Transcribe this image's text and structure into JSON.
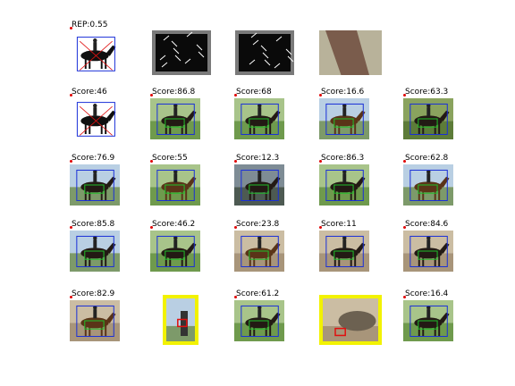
{
  "title": "",
  "header_row": [
    {
      "label": "REP:0.55",
      "kind": "silhouette"
    },
    {
      "label": "",
      "kind": "hog"
    },
    {
      "label": "",
      "kind": "hog"
    },
    {
      "label": "",
      "kind": "patch"
    }
  ],
  "detections": [
    [
      {
        "label": "Score:46",
        "kind": "silhouette",
        "tone": "white",
        "highlight": false
      },
      {
        "label": "Score:86.8",
        "kind": "photo",
        "tone": "grass",
        "highlight": false
      },
      {
        "label": "Score:68",
        "kind": "photo",
        "tone": "grass",
        "highlight": false
      },
      {
        "label": "Score:16.6",
        "kind": "photo",
        "tone": "sky",
        "highlight": false
      },
      {
        "label": "Score:63.3",
        "kind": "photo",
        "tone": "brown",
        "highlight": false
      }
    ],
    [
      {
        "label": "Score:76.9",
        "kind": "photo",
        "tone": "sky",
        "highlight": false
      },
      {
        "label": "Score:55",
        "kind": "photo",
        "tone": "grass",
        "highlight": false
      },
      {
        "label": "Score:12.3",
        "kind": "photo",
        "tone": "dark",
        "highlight": false
      },
      {
        "label": "Score:86.3",
        "kind": "photo",
        "tone": "grass",
        "highlight": false
      },
      {
        "label": "Score:62.8",
        "kind": "photo",
        "tone": "sky",
        "highlight": false
      }
    ],
    [
      {
        "label": "Score:85.8",
        "kind": "photo",
        "tone": "sky",
        "highlight": false
      },
      {
        "label": "Score:46.2",
        "kind": "photo",
        "tone": "grass",
        "highlight": false
      },
      {
        "label": "Score:23.8",
        "kind": "photo",
        "tone": "sand",
        "highlight": false
      },
      {
        "label": "Score:11",
        "kind": "photo",
        "tone": "sand",
        "highlight": false
      },
      {
        "label": "Score:84.6",
        "kind": "photo",
        "tone": "sand",
        "highlight": false
      }
    ],
    [
      {
        "label": "Score:82.9",
        "kind": "photo",
        "tone": "sand",
        "highlight": false
      },
      {
        "label": "",
        "kind": "person",
        "tone": "sky",
        "highlight": true
      },
      {
        "label": "Score:61.2",
        "kind": "photo",
        "tone": "grass",
        "highlight": false
      },
      {
        "label": "",
        "kind": "pile",
        "tone": "sand",
        "highlight": true
      },
      {
        "label": "Score:16.4",
        "kind": "photo",
        "tone": "grass",
        "highlight": false
      }
    ]
  ],
  "colors": {
    "detection_box": "#1a2fd8",
    "part_box": "#1fbf2a",
    "highlight_frame": "#f2f200",
    "highlight_box": "#e01010",
    "marker": "#e00000"
  }
}
